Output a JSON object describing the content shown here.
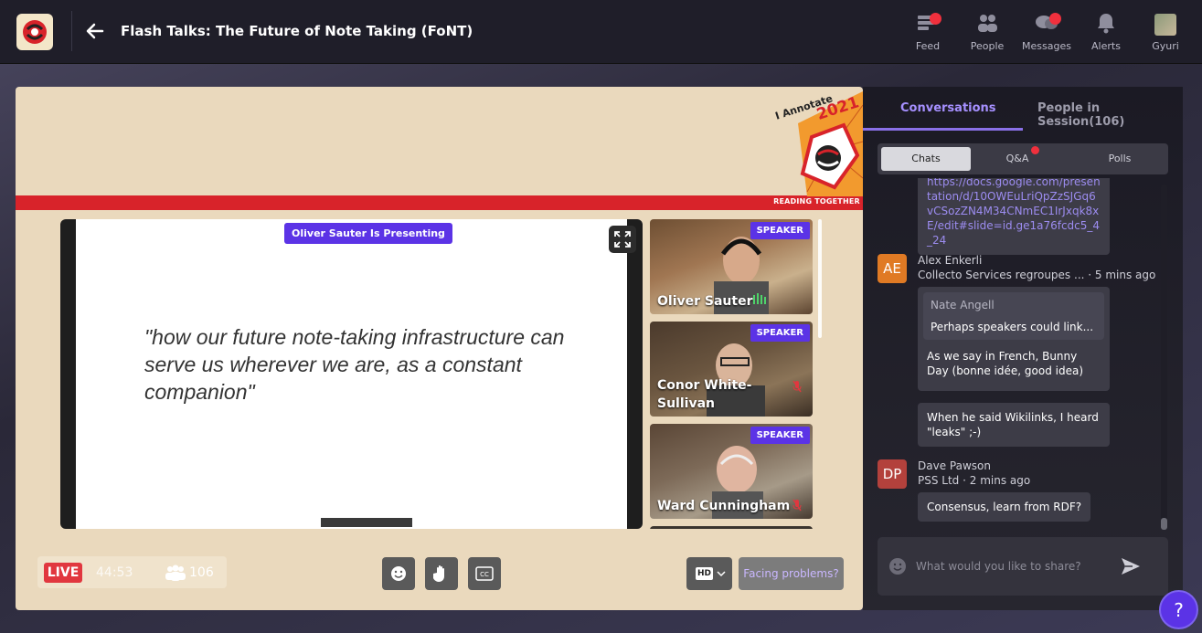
{
  "header": {
    "title": "Flash Talks: The Future of Note Taking (FoNT)",
    "nav": [
      {
        "label": "Feed",
        "icon": "feed-icon",
        "badge": true
      },
      {
        "label": "People",
        "icon": "people-icon",
        "badge": false
      },
      {
        "label": "Messages",
        "icon": "messages-icon",
        "badge": true
      },
      {
        "label": "Alerts",
        "icon": "bell-icon",
        "badge": false
      },
      {
        "label": "Gyuri",
        "icon": "avatar",
        "badge": false
      }
    ]
  },
  "stage": {
    "brand_line1": "I Annotate",
    "brand_year": "2021",
    "reading_together": "READING TOGETHER",
    "presenting_label": "Oliver Sauter Is Presenting",
    "slide_quote": "\"how our future note-taking infrastructure can serve us wherever we are, as a constant companion\"",
    "speakers": [
      {
        "name": "Oliver Sauter",
        "role": "SPEAKER",
        "muted": false
      },
      {
        "name": "Conor White-Sullivan",
        "role": "SPEAKER",
        "muted": true
      },
      {
        "name": "Ward Cunningham",
        "role": "SPEAKER",
        "muted": true
      }
    ],
    "live_label": "LIVE",
    "timer": "44:53",
    "attendee_count": "106",
    "quality": "HD",
    "facing_problems": "Facing problems?"
  },
  "panel": {
    "tabs": [
      {
        "label": "Conversations",
        "active": true
      },
      {
        "label": "People in Session(106)",
        "active": false
      }
    ],
    "segments": [
      {
        "label": "Chats",
        "active": true
      },
      {
        "label": "Q&A",
        "active": false,
        "badge": true
      },
      {
        "label": "Polls",
        "active": false
      }
    ],
    "messages": {
      "link_text": "https://docs.google.com/presentation/d/10OWEuLriQpZzSJGq6vCSozZN4M34CNmEC1IrJxqk8xE/edit#slide=id.ge1a76fcdc5_4_24",
      "m1": {
        "initials": "AE",
        "author": "Alex Enkerli",
        "subtitle": "Collecto Services regroupes ...",
        "time": "· 5 mins ago",
        "quote_author": "Nate Angell",
        "quote_text": "Perhaps speakers could link...",
        "reply": "As we say in French, Bunny Day (bonne idée, good idea)",
        "followup": "When he said Wikilinks, I heard \"leaks\" ;-)"
      },
      "m2": {
        "initials": "DP",
        "author": "Dave Pawson",
        "subtitle": "PSS Ltd",
        "time": "· 2 mins ago",
        "text": "Consensus, learn from RDF?"
      }
    },
    "input_placeholder": "What would you like to share?"
  },
  "help_label": "?",
  "colors": {
    "accent": "#5b33e6",
    "live": "#e1373f",
    "stage_bg": "#ead9bd",
    "band": "#d8232a"
  }
}
